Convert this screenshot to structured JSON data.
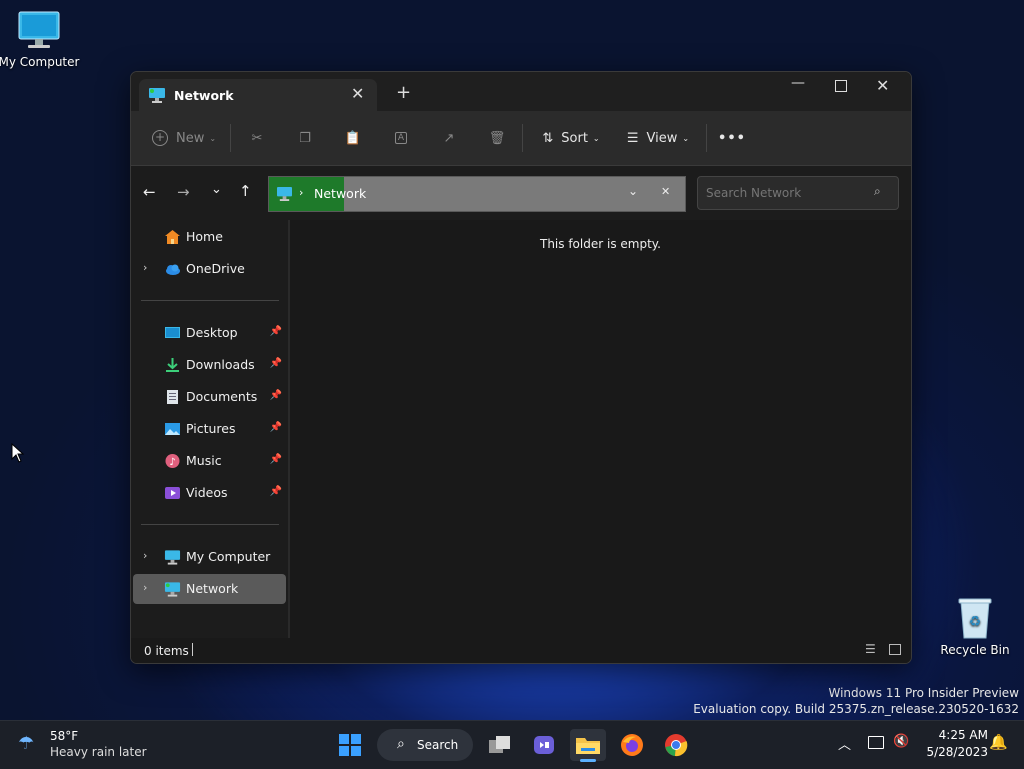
{
  "desktop": {
    "icons": [
      {
        "label": "My Computer"
      },
      {
        "label": "Recycle Bin"
      }
    ],
    "watermark": {
      "line1": "Windows 11 Pro Insider Preview",
      "line2": "Evaluation copy. Build 25375.zn_release.230520-1632"
    }
  },
  "window": {
    "tab_title": "Network",
    "toolbar": {
      "new_label": "New",
      "sort_label": "Sort",
      "view_label": "View"
    },
    "address": {
      "segment": "Network",
      "search_placeholder": "Search Network"
    },
    "nav": {
      "top": [
        {
          "label": "Home",
          "icon": "home-icon"
        },
        {
          "label": "OneDrive",
          "icon": "cloud-icon"
        }
      ],
      "quick_access": [
        {
          "label": "Desktop",
          "icon": "desktop-folder-icon"
        },
        {
          "label": "Downloads",
          "icon": "download-icon"
        },
        {
          "label": "Documents",
          "icon": "document-icon"
        },
        {
          "label": "Pictures",
          "icon": "pictures-icon"
        },
        {
          "label": "Music",
          "icon": "music-icon"
        },
        {
          "label": "Videos",
          "icon": "videos-icon"
        }
      ],
      "devices": [
        {
          "label": "My Computer",
          "icon": "computer-icon"
        },
        {
          "label": "Network",
          "icon": "network-icon",
          "selected": true
        }
      ]
    },
    "content": {
      "empty_message": "This folder is empty."
    },
    "status": {
      "items_count": "0 items"
    }
  },
  "taskbar": {
    "weather": {
      "temp": "58°F",
      "condition": "Heavy rain later"
    },
    "search_label": "Search",
    "clock": {
      "time": "4:25 AM",
      "date": "5/28/2023"
    }
  },
  "colors": {
    "accent_blue": "#1e90ff",
    "selected_nav": "#5a5a5a",
    "address_bg": "#7a7a7a"
  }
}
